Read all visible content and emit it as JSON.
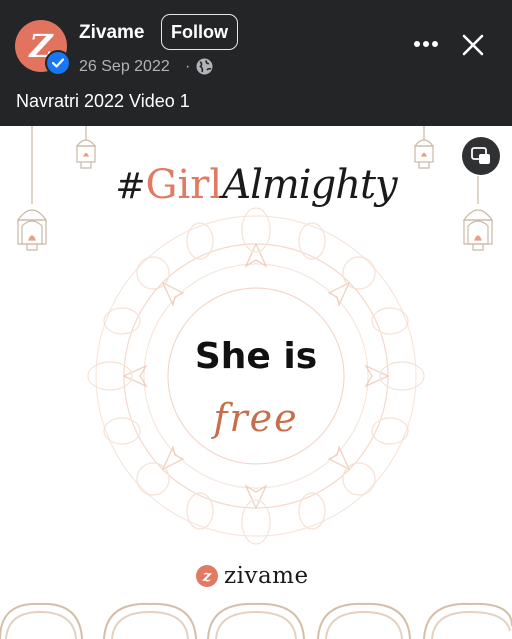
{
  "header": {
    "page_name": "Zivame",
    "avatar_letter": "Z",
    "follow_label": "Follow",
    "date": "26 Sep 2022",
    "separator": "·",
    "caption": "Navratri 2022 Video 1",
    "icons": [
      "verified-badge-icon",
      "globe-icon",
      "more-icon",
      "close-icon"
    ]
  },
  "video": {
    "hashtag": {
      "hash": "#",
      "girl": "Girl",
      "almighty": "Almighty"
    },
    "line1": "She is",
    "line2": "free",
    "brand_mark": "z",
    "brand_name": "zivame",
    "icons": [
      "picture-in-picture-icon",
      "lantern-icon",
      "mandala-decoration"
    ],
    "colors": {
      "accent": "#e07a63",
      "decoration": "#f0c8b4",
      "text": "#1a1a1a"
    }
  }
}
